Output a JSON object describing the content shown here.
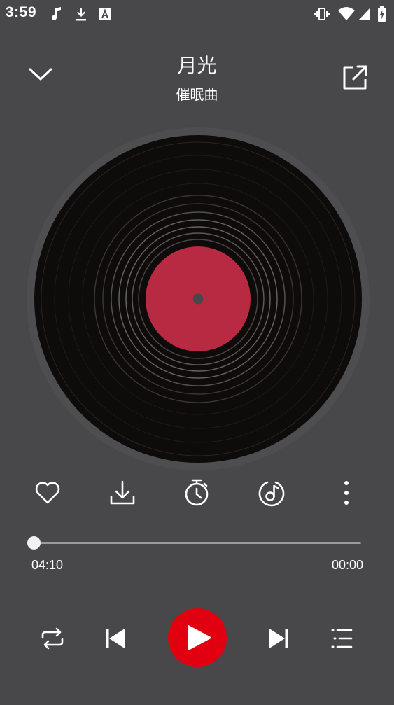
{
  "status_bar": {
    "time": "3:59",
    "left_icons": [
      "music-note-icon",
      "download-icon",
      "font-a-icon"
    ],
    "right_icons": [
      "vibrate-icon",
      "wifi-icon",
      "signal-icon",
      "battery-icon"
    ]
  },
  "header": {
    "title": "月光",
    "artist": "催眠曲"
  },
  "disc": {
    "label_color": "#b82a41",
    "disc_color": "#0e0b0b"
  },
  "actions": [
    {
      "name": "favorite",
      "icon": "heart-icon"
    },
    {
      "name": "download",
      "icon": "download-icon"
    },
    {
      "name": "sleep-timer",
      "icon": "timer-icon"
    },
    {
      "name": "sound-effect",
      "icon": "music-disc-icon"
    },
    {
      "name": "more",
      "icon": "more-vertical-icon"
    }
  ],
  "progress": {
    "elapsed": "04:10",
    "duration": "00:00",
    "fraction": 0
  },
  "controls": {
    "repeat": "repeat-icon",
    "previous": "skip-previous-icon",
    "play": "play-icon",
    "next": "skip-next-icon",
    "playlist": "playlist-icon",
    "accent_color": "#e0000f"
  }
}
